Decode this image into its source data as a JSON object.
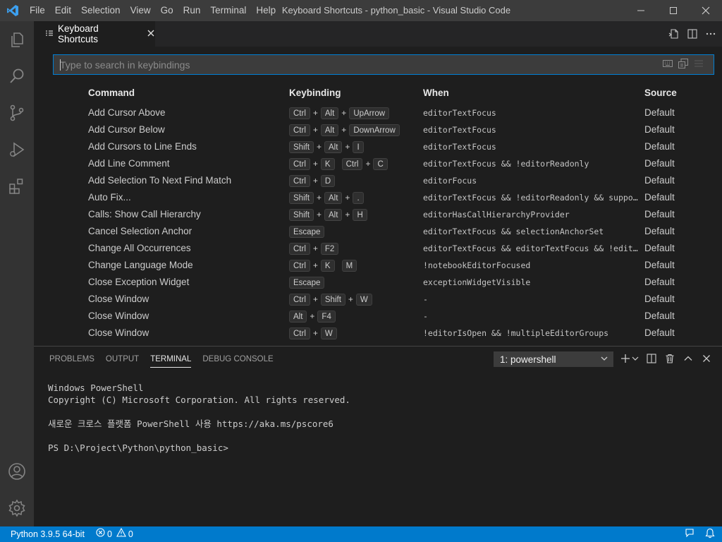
{
  "colors": {
    "titlebar": "#3c3c3c",
    "activitybar": "#333333",
    "editor_bg": "#1e1e1e",
    "statusbar": "#007acc",
    "accent": "#007fd4"
  },
  "menu": [
    "File",
    "Edit",
    "Selection",
    "View",
    "Go",
    "Run",
    "Terminal",
    "Help"
  ],
  "window_title": "Keyboard Shortcuts - python_basic - Visual Studio Code",
  "editor_tab": {
    "label": "Keyboard Shortcuts"
  },
  "search": {
    "placeholder": "Type to search in keybindings",
    "value": ""
  },
  "table": {
    "headers": {
      "command": "Command",
      "keybinding": "Keybinding",
      "when": "When",
      "source": "Source"
    },
    "rows": [
      {
        "command": "Add Cursor Above",
        "keys": [
          [
            "Ctrl",
            "Alt",
            "UpArrow"
          ]
        ],
        "when": "editorTextFocus",
        "source": "Default"
      },
      {
        "command": "Add Cursor Below",
        "keys": [
          [
            "Ctrl",
            "Alt",
            "DownArrow"
          ]
        ],
        "when": "editorTextFocus",
        "source": "Default"
      },
      {
        "command": "Add Cursors to Line Ends",
        "keys": [
          [
            "Shift",
            "Alt",
            "I"
          ]
        ],
        "when": "editorTextFocus",
        "source": "Default"
      },
      {
        "command": "Add Line Comment",
        "keys": [
          [
            "Ctrl",
            "K"
          ],
          [
            "Ctrl",
            "C"
          ]
        ],
        "when": "editorTextFocus && !editorReadonly",
        "source": "Default"
      },
      {
        "command": "Add Selection To Next Find Match",
        "keys": [
          [
            "Ctrl",
            "D"
          ]
        ],
        "when": "editorFocus",
        "source": "Default"
      },
      {
        "command": "Auto Fix...",
        "keys": [
          [
            "Shift",
            "Alt",
            "."
          ]
        ],
        "when": "editorTextFocus && !editorReadonly && supportedCodeAction",
        "source": "Default"
      },
      {
        "command": "Calls: Show Call Hierarchy",
        "keys": [
          [
            "Shift",
            "Alt",
            "H"
          ]
        ],
        "when": "editorHasCallHierarchyProvider",
        "source": "Default"
      },
      {
        "command": "Cancel Selection Anchor",
        "keys": [
          [
            "Escape"
          ]
        ],
        "when": "editorTextFocus && selectionAnchorSet",
        "source": "Default"
      },
      {
        "command": "Change All Occurrences",
        "keys": [
          [
            "Ctrl",
            "F2"
          ]
        ],
        "when": "editorTextFocus && editorTextFocus && !editorReadonly",
        "source": "Default"
      },
      {
        "command": "Change Language Mode",
        "keys": [
          [
            "Ctrl",
            "K"
          ],
          [
            "M"
          ]
        ],
        "when": "!notebookEditorFocused",
        "source": "Default"
      },
      {
        "command": "Close Exception Widget",
        "keys": [
          [
            "Escape"
          ]
        ],
        "when": "exceptionWidgetVisible",
        "source": "Default"
      },
      {
        "command": "Close Window",
        "keys": [
          [
            "Ctrl",
            "Shift",
            "W"
          ]
        ],
        "when": " -",
        "source": "Default"
      },
      {
        "command": "Close Window",
        "keys": [
          [
            "Alt",
            "F4"
          ]
        ],
        "when": " -",
        "source": "Default"
      },
      {
        "command": "Close Window",
        "keys": [
          [
            "Ctrl",
            "W"
          ]
        ],
        "when": "!editorIsOpen && !multipleEditorGroups",
        "source": "Default"
      }
    ]
  },
  "panel": {
    "tabs": [
      "PROBLEMS",
      "OUTPUT",
      "TERMINAL",
      "DEBUG CONSOLE"
    ],
    "active_tab": "TERMINAL",
    "terminal_select": "1: powershell",
    "terminal_lines": [
      "Windows PowerShell",
      "Copyright (C) Microsoft Corporation. All rights reserved.",
      "",
      "새로운 크로스 플랫폼 PowerShell 사용 https://aka.ms/pscore6",
      "",
      "PS D:\\Project\\Python\\python_basic>"
    ]
  },
  "statusbar": {
    "python": "Python 3.9.5 64-bit",
    "errors": "0",
    "warnings": "0"
  }
}
